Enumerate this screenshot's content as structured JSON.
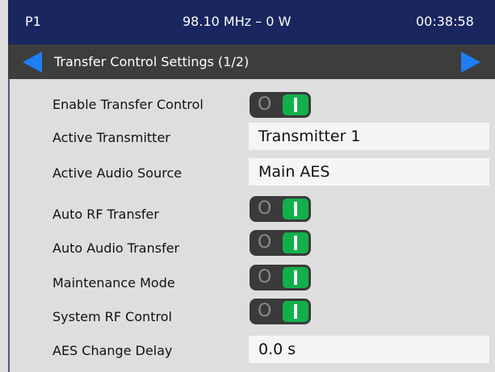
{
  "status_bar": {
    "preset": "P1",
    "frequency_power": "98.10 MHz – 0 W",
    "clock": "00:38:58"
  },
  "title_bar": {
    "title": "Transfer Control Settings (1/2)"
  },
  "colors": {
    "status_bar_bg": "#19265f",
    "title_bar_bg": "#3d3d3d",
    "arrow": "#1d7ff5",
    "toggle_on": "#11b04b",
    "panel_bg": "#dedede"
  },
  "settings": {
    "enable_transfer_control": {
      "label": "Enable Transfer Control",
      "state": "on"
    },
    "active_transmitter": {
      "label": "Active Transmitter",
      "value": "Transmitter 1"
    },
    "active_audio_source": {
      "label": "Active Audio Source",
      "value": "Main AES"
    },
    "auto_rf_transfer": {
      "label": "Auto RF Transfer",
      "state": "on"
    },
    "auto_audio_transfer": {
      "label": "Auto Audio Transfer",
      "state": "on"
    },
    "maintenance_mode": {
      "label": "Maintenance Mode",
      "state": "on"
    },
    "system_rf_control": {
      "label": "System RF Control",
      "state": "on"
    },
    "aes_change_delay": {
      "label": "AES Change Delay",
      "value": "0.0 s"
    }
  },
  "toggle_glyphs": {
    "off": "O"
  }
}
